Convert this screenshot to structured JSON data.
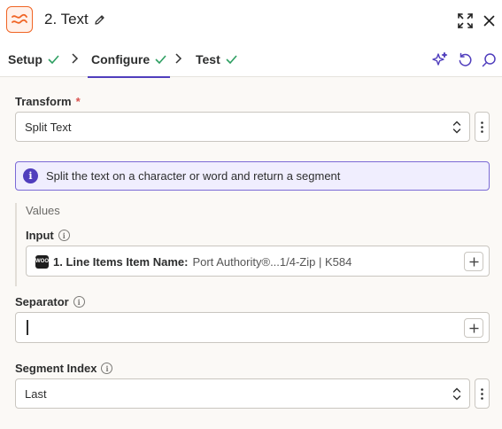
{
  "header": {
    "app_icon": "zapier-formatter-icon",
    "title": "2. Text",
    "edit_icon": "pencil-icon",
    "expand_icon": "expand-icon",
    "close_icon": "close-icon"
  },
  "tabs": [
    {
      "label": "Setup",
      "status": "complete"
    },
    {
      "label": "Configure",
      "status": "complete",
      "active": true
    },
    {
      "label": "Test",
      "status": "complete"
    }
  ],
  "toolbar": {
    "ai_icon": "sparkle-icon",
    "undo_icon": "undo-icon",
    "search_icon": "search-icon"
  },
  "transform": {
    "label": "Transform",
    "required_mark": "*",
    "value": "Split Text"
  },
  "info": {
    "icon_text": "i",
    "text": "Split the text on a character or word and return a segment"
  },
  "values": {
    "title": "Values",
    "input": {
      "label": "Input",
      "pill_icon_text": "WOO",
      "pill_key": "1. Line Items Item Name:",
      "pill_value": "Port Authority®...1/4-Zip | K584"
    }
  },
  "separator": {
    "label": "Separator",
    "value": ""
  },
  "segment_index": {
    "label": "Segment Index",
    "value": "Last"
  },
  "colors": {
    "accent": "#503ebd",
    "brand": "#f06424",
    "check": "#2e9f62",
    "info_bg": "#f0eefe"
  }
}
